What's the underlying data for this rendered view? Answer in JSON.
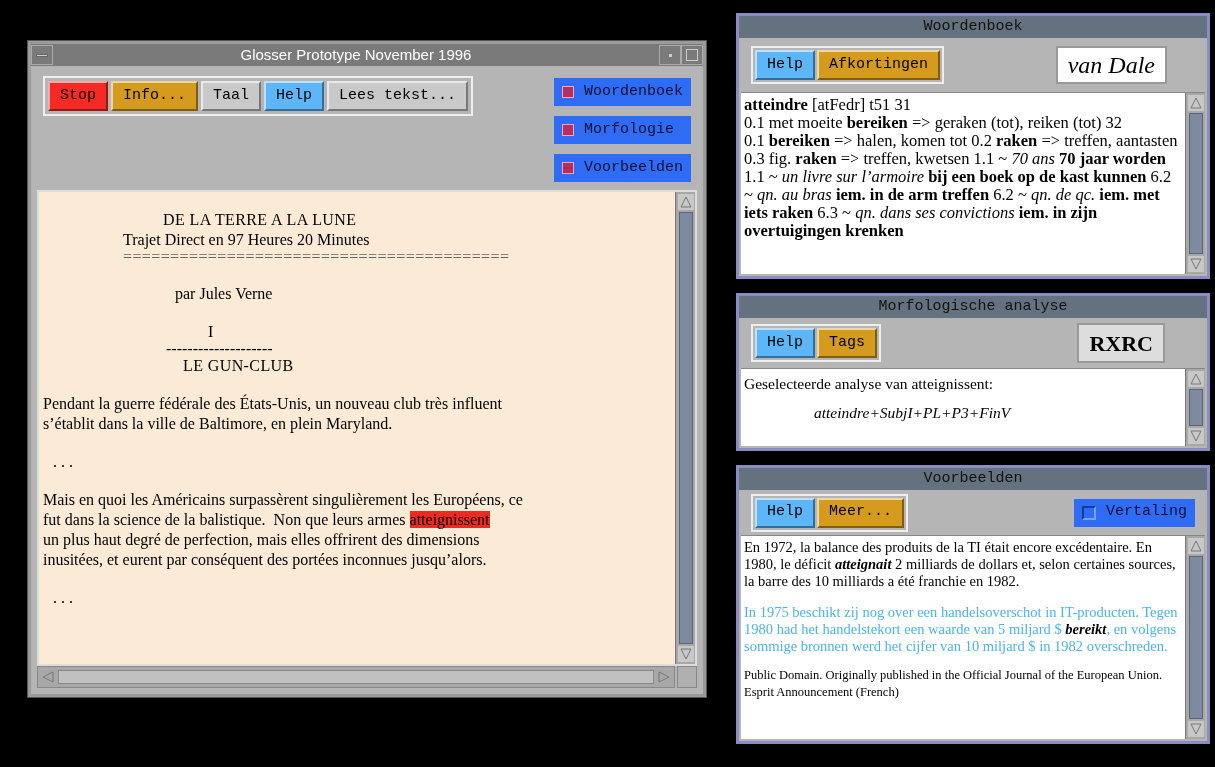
{
  "main_window": {
    "title": "Glosser Prototype November 1996",
    "buttons": [
      {
        "label": "Stop",
        "color": "#f52a24"
      },
      {
        "label": "Info...",
        "color": "#d49b1e"
      },
      {
        "label": "Taal",
        "color": "#c9c9c9"
      },
      {
        "label": "Help",
        "color": "#5cb6f7"
      },
      {
        "label": "Lees tekst...",
        "color": "#c9c9c9"
      }
    ],
    "toggles": [
      {
        "label": "Woordenboek",
        "checked": true
      },
      {
        "label": "Morfologie",
        "checked": true
      },
      {
        "label": "Voorbeelden",
        "checked": true
      }
    ],
    "text": [
      {
        "kind": "title",
        "text": "DE LA TERRE A LA LUNE"
      },
      {
        "kind": "subtitle",
        "text": "Trajet Direct en 97 Heures 20 Minutes"
      },
      {
        "kind": "rule",
        "text": "========================================="
      },
      {
        "kind": "author",
        "text": "par Jules Verne"
      },
      {
        "kind": "numeral",
        "text": "I"
      },
      {
        "kind": "dashes",
        "text": "--------------------"
      },
      {
        "kind": "chapter",
        "text": "LE GUN-CLUB"
      },
      {
        "kind": "para",
        "lines": [
          {
            "text": "Pendant la guerre fédérale des États-Unis, un nouveau club très influent"
          },
          {
            "text": "s’établit dans la ville de Baltimore, en plein Maryland."
          }
        ]
      },
      {
        "kind": "ellipsis",
        "text": ". . ."
      },
      {
        "kind": "para",
        "lines": [
          {
            "text": "Mais en quoi les Américains surpassèrent singulièrement les Européens, ce"
          },
          {
            "text": "fut dans la science de la balistique.  Non que leurs armes",
            "highlight": "atteignissent"
          },
          {
            "text": "un plus haut degré de perfection, mais elles offrirent des dimensions"
          },
          {
            "text": "inusitées, et eurent par conséquent des portées inconnues jusqu’alors."
          }
        ]
      },
      {
        "kind": "ellipsis",
        "text": ". . ."
      }
    ]
  },
  "dictionary": {
    "title": "Woordenboek",
    "buttons": [
      {
        "label": "Help",
        "color": "#5cb6f7"
      },
      {
        "label": "Afkortingen",
        "color": "#d49b1e"
      }
    ],
    "logo": "van Dale",
    "entry": "**atteindre** [atFedr] t51 31\n0.1 met moeite **bereiken** => geraken (tot), reiken (tot) 32\n0.1 **bereiken** => halen, komen tot 0.2 **raken** => treffen, aantasten 0.3 fig. **raken** => treffen, kwetsen 1.1 ~ *70 ans* **70 jaar worden** 1.1 ~ *un livre sur l’armoire* **bij een boek op de kast kunnen** 6.2 ~ *qn. au bras* **iem. in de arm treffen** 6.2 ~ *qn. de qc.* **iem. met iets raken** 6.3 ~ *qn. dans ses convictions* **iem. in zijn overtuigingen krenken**"
  },
  "morphology": {
    "title": "Morfologische analyse",
    "buttons": [
      {
        "label": "Help",
        "color": "#5cb6f7"
      },
      {
        "label": "Tags",
        "color": "#d49b1e"
      }
    ],
    "logo": "RXRC",
    "caption": "Geselecteerde analyse van atteignissent:",
    "analysis": "atteindre+SubjI+PL+P3+FinV"
  },
  "examples": {
    "title": "Voorbeelden",
    "buttons": [
      {
        "label": "Help",
        "color": "#5cb6f7"
      },
      {
        "label": "Meer...",
        "color": "#d49b1e"
      }
    ],
    "toggle": {
      "label": "Vertaling",
      "checked": false
    },
    "paragraphs": [
      {
        "kind": "source",
        "text": "En 1972, la balance des produits de la TI était encore excédentaire. En 1980, le déficit **atteignait** 2 milliards de dollars et, selon certaines sources, la barre des 10 milliards a été franchie en 1982."
      },
      {
        "kind": "translation",
        "text": "In 1975 beschikt zij nog over een handelsoverschot in IT-producten. Tegen 1980 had het handelstekort  een  waarde van 5 miljard $ **bereikt**, en volgens sommige bronnen werd het cijfer van 10 miljard $ in 1982 overschreden."
      },
      {
        "kind": "credit",
        "text": "Public Domain. Originally published in the Official Journal of the European Union. Esprit Announcement (French)"
      }
    ]
  }
}
